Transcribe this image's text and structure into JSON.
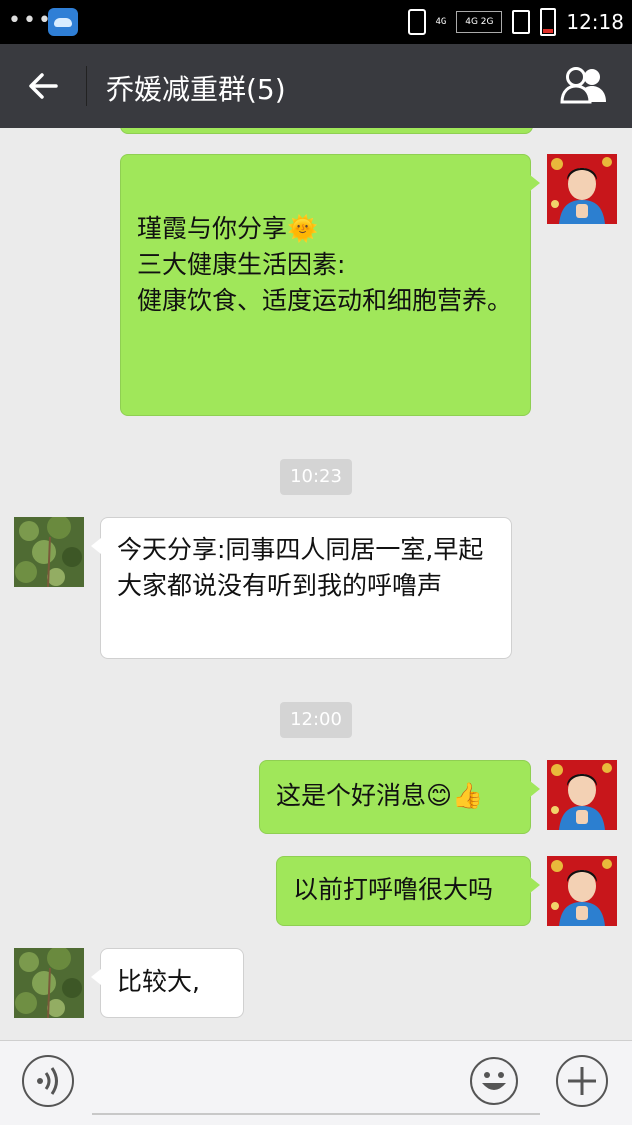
{
  "status_bar": {
    "time": "12:18",
    "network_top": "4G",
    "network_sub": "4G 2G"
  },
  "header": {
    "title": "乔媛减重群(5)"
  },
  "messages": [
    {
      "side": "out",
      "text": "瑾霞与你分享🌞\n三大健康生活因素:\n健康饮食、适度运动和细胞营养。"
    },
    {
      "side": "time",
      "text": "10:23"
    },
    {
      "side": "in",
      "text": "今天分享:同事四人同居一室,早起大家都说没有听到我的呼噜声"
    },
    {
      "side": "time",
      "text": "12:00"
    },
    {
      "side": "out",
      "text": "这是个好消息😊👍"
    },
    {
      "side": "out",
      "text": "以前打呼噜很大吗"
    },
    {
      "side": "in",
      "text": "比较大,"
    }
  ],
  "icons": {
    "back": "arrow-left",
    "members": "people",
    "voice": "voice",
    "emoji": "smiley",
    "plus": "plus"
  },
  "colors": {
    "header_bg": "#393a3f",
    "outgoing_bubble": "#a0e75a",
    "incoming_bubble": "#ffffff",
    "chat_bg": "#ebebeb"
  }
}
